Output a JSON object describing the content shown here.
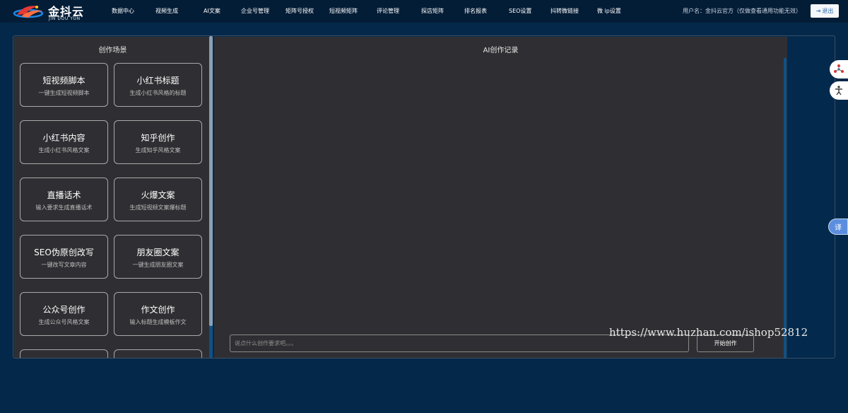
{
  "logo": {
    "name": "金抖云",
    "sub": "JIN DOU YUN"
  },
  "nav": [
    {
      "label": "数据中心"
    },
    {
      "label": "视频生成"
    },
    {
      "label": "AI文案"
    },
    {
      "label": "企业号管理"
    },
    {
      "label": "矩阵号授权"
    },
    {
      "label": "短视频矩阵"
    },
    {
      "label": "评论管理"
    },
    {
      "label": "探店矩阵"
    },
    {
      "label": "排名报表"
    },
    {
      "label": "SEO设置"
    },
    {
      "label": "抖转微链接"
    },
    {
      "label": "微 ip设置"
    }
  ],
  "user": {
    "info": "用户名：金抖云官方（仅做查看通用功能无效）",
    "logout_label": "退出",
    "logout_icon": "logout-icon"
  },
  "left_panel": {
    "title": "创作场景",
    "cards": [
      {
        "title": "短视频脚本",
        "subtitle": "一键生成短视频脚本"
      },
      {
        "title": "小红书标题",
        "subtitle": "生成小红书风格的标题"
      },
      {
        "title": "小红书内容",
        "subtitle": "生成小红书风格文案"
      },
      {
        "title": "知乎创作",
        "subtitle": "生成知乎风格文案"
      },
      {
        "title": "直播话术",
        "subtitle": "输入要求生成直播话术"
      },
      {
        "title": "火爆文案",
        "subtitle": "生成短视频文案爆标题"
      },
      {
        "title": "SEO伪原创改写",
        "subtitle": "一键改写文章内容"
      },
      {
        "title": "朋友圈文案",
        "subtitle": "一键生成朋友圈文案"
      },
      {
        "title": "公众号创作",
        "subtitle": "生成公众号风格文案"
      },
      {
        "title": "作文创作",
        "subtitle": "输入标题生成模板作文"
      },
      {
        "title": "",
        "subtitle": ""
      },
      {
        "title": "",
        "subtitle": ""
      }
    ]
  },
  "right_panel": {
    "title": "AI创作记录",
    "input_placeholder": "说点什么创作要求吧。。。",
    "input_value": "",
    "start_label": "开始创作"
  },
  "watermark": "https://www.huzhan.com/ishop52812",
  "side_widgets": {
    "translate_label": "译",
    "icons": [
      "network-icon",
      "accessibility-icon"
    ]
  },
  "colors": {
    "background": "#03284a",
    "topbar": "#041d37",
    "panel": "#2f2f33",
    "accent": "#0f5185"
  }
}
